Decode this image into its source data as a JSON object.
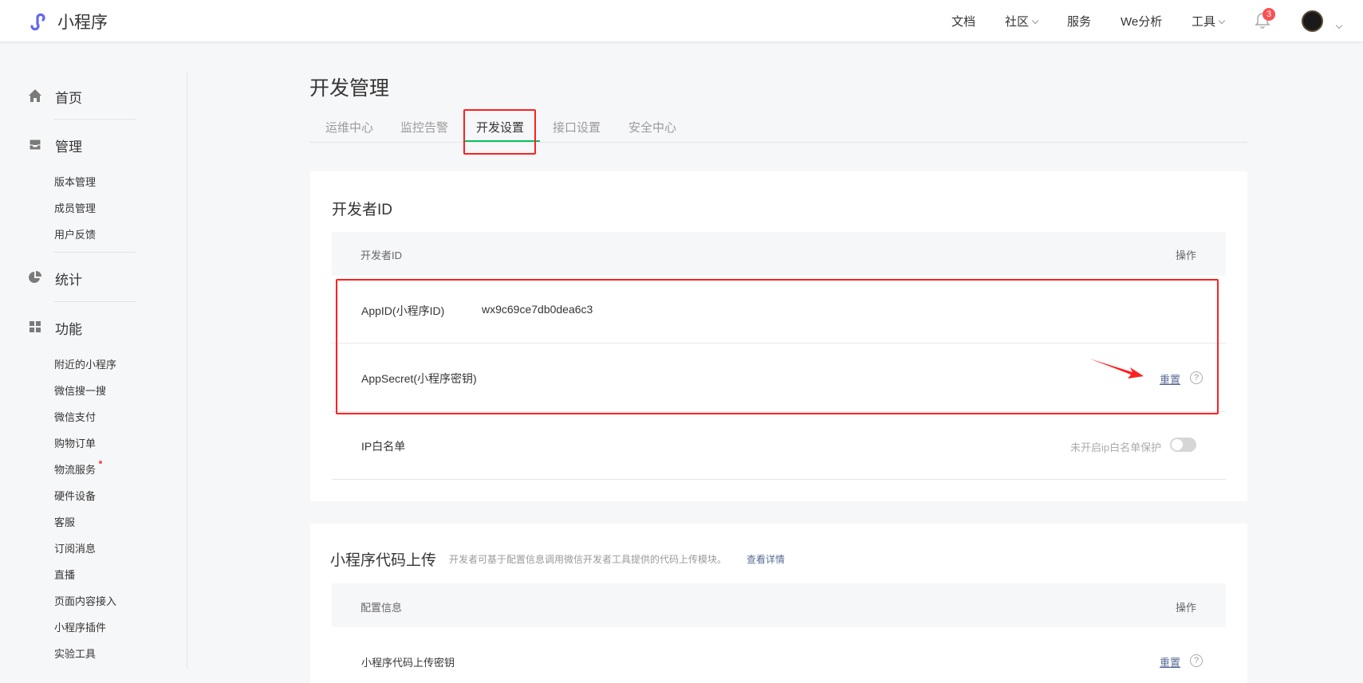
{
  "header": {
    "logo_text": "小程序",
    "nav": [
      {
        "label": "文档"
      },
      {
        "label": "社区",
        "dropdown": true
      },
      {
        "label": "服务"
      },
      {
        "label": "We分析"
      },
      {
        "label": "工具",
        "dropdown": true
      }
    ],
    "notification_count": "3"
  },
  "sidebar": {
    "home": "首页",
    "manage": "管理",
    "manage_items": [
      "版本管理",
      "成员管理",
      "用户反馈"
    ],
    "stats": "统计",
    "features": "功能",
    "feature_items": [
      "附近的小程序",
      "微信搜一搜",
      "微信支付",
      "购物订单",
      "物流服务",
      "硬件设备",
      "客服",
      "订阅消息",
      "直播",
      "页面内容接入",
      "小程序插件",
      "实验工具"
    ]
  },
  "page": {
    "title": "开发管理",
    "tabs": [
      "运维中心",
      "监控告警",
      "开发设置",
      "接口设置",
      "安全中心"
    ],
    "active_tab": "开发设置"
  },
  "dev_id": {
    "title": "开发者ID",
    "col_id": "开发者ID",
    "col_action": "操作",
    "appid_label": "AppID(小程序ID)",
    "appid_value": "wx9c69ce7db0dea6c3",
    "secret_label": "AppSecret(小程序密钥)",
    "reset": "重置",
    "help": "?",
    "ip_label": "IP白名单",
    "ip_status": "未开启ip白名单保护",
    "ip_enabled": false
  },
  "upload": {
    "title": "小程序代码上传",
    "desc": "开发者可基于配置信息调用微信开发者工具提供的代码上传模块。",
    "link": "查看详情",
    "col_config": "配置信息",
    "col_action": "操作",
    "row_label": "小程序代码上传密钥",
    "reset": "重置",
    "help": "?"
  },
  "colors": {
    "accent": "#07c160",
    "link": "#576b95",
    "annotation": "#ff2020",
    "badge": "#fa5151"
  }
}
